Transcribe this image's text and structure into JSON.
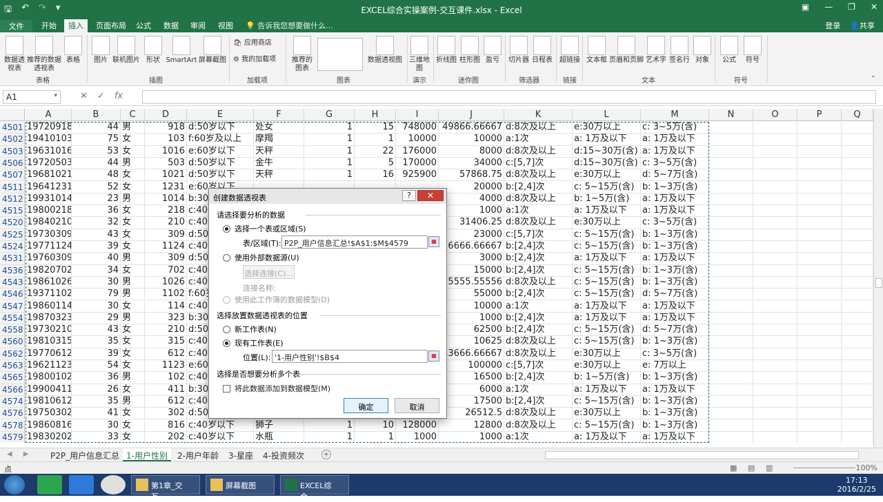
{
  "window": {
    "title": "EXCEL综合实操案例-交互课件.xlsx - Excel"
  },
  "ribbon_tabs": [
    "文件",
    "开始",
    "插入",
    "页面布局",
    "公式",
    "数据",
    "审阅",
    "视图"
  ],
  "active_tab": "插入",
  "tell_me": "告诉我您想要做什么...",
  "account": {
    "login": "登录",
    "share": "共享"
  },
  "ribbon": {
    "buttons": [
      "数据透视表",
      "推荐的数据透视表",
      "表格",
      "图片",
      "联机图片",
      "形状",
      "SmartArt",
      "屏幕截图",
      "应用商店",
      "我的加载项",
      "推荐的图表",
      "数据透视图",
      "三维地图",
      "折线图",
      "柱形图",
      "盈亏",
      "切片器",
      "日程表",
      "超链接",
      "文本框",
      "页眉和页脚",
      "艺术字",
      "签名行",
      "对象",
      "公式",
      "符号"
    ],
    "groups": [
      "表格",
      "插图",
      "加载项",
      "图表",
      "演示",
      "迷你图",
      "筛选器",
      "链接",
      "文本",
      "符号"
    ]
  },
  "formula_bar": {
    "name_box": "A1",
    "fx": "fx",
    "content": ""
  },
  "columns": [
    "A",
    "B",
    "C",
    "D",
    "E",
    "F",
    "G",
    "H",
    "I",
    "J",
    "K",
    "L",
    "M",
    "N",
    "O",
    "P",
    "Q"
  ],
  "rows": [
    {
      "n": "4501",
      "A": "19720918",
      "B": "44",
      "C": "男",
      "D": "918",
      "E": "d:50岁以下",
      "F": "处女",
      "G": "1",
      "H": "15",
      "I": "748000",
      "J": "49866.66667",
      "K": "d:8次及以上",
      "L": "e:30万以上",
      "M": "c: 3~5万(含)"
    },
    {
      "n": "4502",
      "A": "19410103",
      "B": "75",
      "C": "女",
      "D": "103",
      "E": "f:60岁及以上",
      "F": "摩羯",
      "G": "1",
      "H": "1",
      "I": "10000",
      "J": "10000",
      "K": "a:1次",
      "L": "a: 1万及以下",
      "M": "a: 1万及以下"
    },
    {
      "n": "4503",
      "A": "19631016",
      "B": "53",
      "C": "女",
      "D": "1016",
      "E": "e:60岁以下",
      "F": "天秤",
      "G": "1",
      "H": "22",
      "I": "176000",
      "J": "8000",
      "K": "d:8次及以上",
      "L": "d:15~30万(含)",
      "M": "a: 1万及以下"
    },
    {
      "n": "4506",
      "A": "19720503",
      "B": "44",
      "C": "男",
      "D": "503",
      "E": "d:50岁以下",
      "F": "金牛",
      "G": "1",
      "H": "5",
      "I": "170000",
      "J": "34000",
      "K": "c:[5,7]次",
      "L": "d:15~30万(含)",
      "M": "c: 3~5万(含)"
    },
    {
      "n": "4507",
      "A": "19681021",
      "B": "48",
      "C": "女",
      "D": "1021",
      "E": "d:50岁以下",
      "F": "天秤",
      "G": "1",
      "H": "16",
      "I": "925900",
      "J": "57868.75",
      "K": "d:8次及以上",
      "L": "e:30万以上",
      "M": "d: 5~7万(含)"
    },
    {
      "n": "4511",
      "A": "19641231",
      "B": "52",
      "C": "女",
      "D": "1231",
      "E": "e:60岁以下",
      "F": "",
      "G": "",
      "H": "",
      "I": "",
      "J": "20000",
      "K": "b:[2,4]次",
      "L": "c: 5~15万(含)",
      "M": "b: 1~3万(含)"
    },
    {
      "n": "4512",
      "A": "19931014",
      "B": "23",
      "C": "男",
      "D": "1014",
      "E": "b:30",
      "F": "",
      "G": "",
      "H": "",
      "I": "",
      "J": "4000",
      "K": "d:8次及以上",
      "L": "b: 1~5万(含)",
      "M": "a: 1万及以下"
    },
    {
      "n": "4515",
      "A": "19800218",
      "B": "36",
      "C": "女",
      "D": "218",
      "E": "c:40岁",
      "F": "",
      "G": "",
      "H": "",
      "I": "",
      "J": "1000",
      "K": "a:1次",
      "L": "a: 1万及以下",
      "M": "a: 1万及以下"
    },
    {
      "n": "4520",
      "A": "19840210",
      "B": "32",
      "C": "女",
      "D": "210",
      "E": "c:40岁",
      "F": "",
      "G": "",
      "H": "",
      "I": "",
      "J": "31406.25",
      "K": "d:8次及以上",
      "L": "e:30万以上",
      "M": "c: 3~5万(含)"
    },
    {
      "n": "4525",
      "A": "19730309",
      "B": "43",
      "C": "女",
      "D": "309",
      "E": "d:50岁",
      "F": "",
      "G": "",
      "H": "",
      "I": "",
      "J": "23000",
      "K": "c:[5,7]次",
      "L": "c: 5~15万(含)",
      "M": "b: 1~3万(含)"
    },
    {
      "n": "4524",
      "A": "19771124",
      "B": "39",
      "C": "女",
      "D": "1124",
      "E": "c:40岁",
      "F": "",
      "G": "",
      "H": "",
      "I": "",
      "J": "26666.66667",
      "K": "b:[2,4]次",
      "L": "c: 5~15万(含)",
      "M": "b: 1~3万(含)"
    },
    {
      "n": "4531",
      "A": "19760309",
      "B": "40",
      "C": "男",
      "D": "309",
      "E": "d:50岁",
      "F": "",
      "G": "",
      "H": "",
      "I": "",
      "J": "3000",
      "K": "b:[2,4]次",
      "L": "a: 1万及以下",
      "M": "a: 1万及以下"
    },
    {
      "n": "4536",
      "A": "19820702",
      "B": "34",
      "C": "女",
      "D": "702",
      "E": "c:40岁",
      "F": "",
      "G": "",
      "H": "",
      "I": "",
      "J": "15000",
      "K": "b:[2,4]次",
      "L": "c: 5~15万(含)",
      "M": "b: 1~3万(含)"
    },
    {
      "n": "4543",
      "A": "19861026",
      "B": "30",
      "C": "男",
      "D": "1026",
      "E": "c:40岁",
      "F": "",
      "G": "",
      "H": "",
      "I": "",
      "J": "15555.55556",
      "K": "d:8次及以上",
      "L": "c: 5~15万(含)",
      "M": "b: 1~3万(含)"
    },
    {
      "n": "4546",
      "A": "19371102",
      "B": "79",
      "C": "男",
      "D": "1102",
      "E": "f:60岁",
      "F": "",
      "G": "",
      "H": "",
      "I": "",
      "J": "55000",
      "K": "b:[2,4]次",
      "L": "c: 5~15万(含)",
      "M": "d: 5~7万(含)"
    },
    {
      "n": "4547",
      "A": "19860114",
      "B": "30",
      "C": "女",
      "D": "114",
      "E": "c:40岁",
      "F": "",
      "G": "",
      "H": "",
      "I": "",
      "J": "10000",
      "K": "a:1次",
      "L": "a: 1万及以下",
      "M": "a: 1万及以下"
    },
    {
      "n": "4554",
      "A": "19870323",
      "B": "29",
      "C": "男",
      "D": "323",
      "E": "b:30岁",
      "F": "",
      "G": "",
      "H": "",
      "I": "",
      "J": "1000",
      "K": "b:[2,4]次",
      "L": "a: 1万及以下",
      "M": "a: 1万及以下"
    },
    {
      "n": "4558",
      "A": "19730210",
      "B": "43",
      "C": "女",
      "D": "210",
      "E": "d:50岁",
      "F": "",
      "G": "",
      "H": "",
      "I": "",
      "J": "62500",
      "K": "b:[2,4]次",
      "L": "c: 5~15万(含)",
      "M": "d: 5~7万(含)"
    },
    {
      "n": "4560",
      "A": "19810315",
      "B": "35",
      "C": "女",
      "D": "315",
      "E": "c:40岁",
      "F": "",
      "G": "",
      "H": "",
      "I": "",
      "J": "10625",
      "K": "d:8次及以上",
      "L": "c: 5~15万(含)",
      "M": "b: 1~3万(含)"
    },
    {
      "n": "4562",
      "A": "19770612",
      "B": "39",
      "C": "女",
      "D": "612",
      "E": "c:40岁",
      "F": "",
      "G": "",
      "H": "",
      "I": "",
      "J": "33666.66667",
      "K": "d:8次及以上",
      "L": "e:30万以上",
      "M": "c: 3~5万(含)"
    },
    {
      "n": "4563",
      "A": "19621123",
      "B": "54",
      "C": "女",
      "D": "1123",
      "E": "e:60岁",
      "F": "",
      "G": "",
      "H": "",
      "I": "",
      "J": "100000",
      "K": "c:[5,7]次",
      "L": "e:30万以上",
      "M": "e: 7万以上"
    },
    {
      "n": "4565",
      "A": "19800102",
      "B": "36",
      "C": "男",
      "D": "102",
      "E": "c:40岁",
      "F": "",
      "G": "",
      "H": "",
      "I": "",
      "J": "16500",
      "K": "b:[2,4]次",
      "L": "b: 1~5万(含)",
      "M": "b: 1~3万(含)"
    },
    {
      "n": "4566",
      "A": "19900411",
      "B": "26",
      "C": "女",
      "D": "411",
      "E": "b:30岁",
      "F": "",
      "G": "",
      "H": "",
      "I": "",
      "J": "6000",
      "K": "a:1次",
      "L": "a: 1万及以下",
      "M": "a: 1万及以下"
    },
    {
      "n": "4574",
      "A": "19810612",
      "B": "35",
      "C": "男",
      "D": "612",
      "E": "c:40岁",
      "F": "",
      "G": "",
      "H": "",
      "I": "",
      "J": "17500",
      "K": "b:[2,4]次",
      "L": "c: 5~15万(含)",
      "M": "b: 1~3万(含)"
    },
    {
      "n": "4576",
      "A": "19750302",
      "B": "41",
      "C": "女",
      "D": "302",
      "E": "d:50岁",
      "F": "",
      "G": "",
      "H": "",
      "I": "",
      "J": "26512.5",
      "K": "d:8次及以上",
      "L": "e:30万以上",
      "M": "b: 1~3万(含)"
    },
    {
      "n": "4578",
      "A": "19860816",
      "B": "30",
      "C": "女",
      "D": "816",
      "E": "c:40岁以下",
      "F": "狮子",
      "G": "1",
      "H": "10",
      "I": "128000",
      "J": "12800",
      "K": "d:8次及以上",
      "L": "c: 5~15万(含)",
      "M": "b: 1~3万(含)"
    },
    {
      "n": "4579",
      "A": "19830202",
      "B": "33",
      "C": "女",
      "D": "202",
      "E": "c:40岁以下",
      "F": "水瓶",
      "G": "1",
      "H": "1",
      "I": "1000",
      "J": "1000",
      "K": "a:1次",
      "L": "a: 1万及以下",
      "M": "a: 1万及以下"
    }
  ],
  "sheet_tabs": [
    "P2P_用户信息汇总",
    "1-用户性别",
    "2-用户年龄",
    "3-星座",
    "4-投资频次"
  ],
  "active_sheet": "1-用户性别",
  "status": {
    "mode": "点",
    "zoom": "100%"
  },
  "taskbar": {
    "tasks": [
      "第1章_交互...",
      "屏幕截图",
      "EXCEL综合..."
    ],
    "time": "17:13",
    "date": "2016/2/25"
  },
  "dialog": {
    "title": "创建数据透视表",
    "help": "?",
    "close": "✕",
    "sec1": "请选择要分析的数据",
    "opt_table": "选择一个表或区域(S)",
    "range_label": "表/区域(T):",
    "range_value": "P2P_用户信息汇总!$A$1:$M$4579",
    "opt_external": "使用外部数据源(U)",
    "choose_conn": "选择连接(C)...",
    "conn_name": "连接名称:",
    "opt_model": "使用此工作簿的数据模型(D)",
    "sec2": "选择放置数据透视表的位置",
    "opt_new": "新工作表(N)",
    "opt_existing": "现有工作表(E)",
    "loc_label": "位置(L):",
    "loc_value": "'1-用户性别'!$B$4",
    "sec3": "选择是否想要分析多个表",
    "add_model": "将此数据添加到数据模型(M)",
    "ok": "确定",
    "cancel": "取消"
  }
}
